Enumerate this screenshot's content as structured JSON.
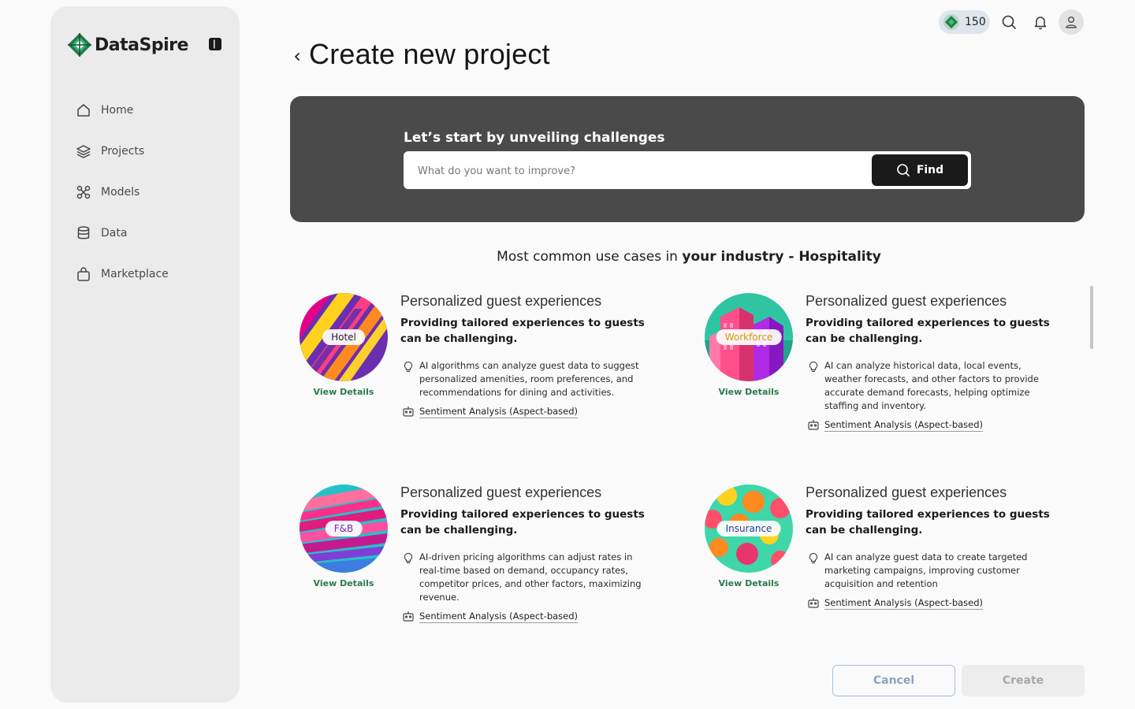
{
  "app": {
    "name": "DataSpire"
  },
  "sidebar": {
    "items": [
      {
        "label": "Home",
        "icon": "home-icon"
      },
      {
        "label": "Projects",
        "icon": "layers-icon"
      },
      {
        "label": "Models",
        "icon": "models-icon"
      },
      {
        "label": "Data",
        "icon": "database-icon"
      },
      {
        "label": "Marketplace",
        "icon": "shopping-bag-icon"
      }
    ]
  },
  "topbar": {
    "credits": "150"
  },
  "header": {
    "title": "Create new project"
  },
  "hero": {
    "title": "Let’s start by unveiling challenges",
    "search_placeholder": "What do you want to improve?",
    "find_label": "Find"
  },
  "industry": {
    "prefix": "Most common use cases in ",
    "emphasis": "your industry - Hospitality"
  },
  "use_cases": [
    {
      "tag": "Hotel",
      "view_details": "View Details",
      "title": "Personalized guest experiences",
      "subtitle": "Providing tailored experiences to guests can be challenging.",
      "description": "AI algorithms can analyze guest data to suggest personalized amenities, room preferences, and recommendations for dining and activities.",
      "model": "Sentiment Analysis (Aspect-based)"
    },
    {
      "tag": "Workforce",
      "view_details": "View Details",
      "title": "Personalized guest experiences",
      "subtitle": "Providing tailored experiences to guests can be challenging.",
      "description": "AI can analyze historical data, local events, weather forecasts, and other factors to provide accurate demand forecasts, helping optimize staffing and inventory.",
      "model": "Sentiment Analysis (Aspect-based)"
    },
    {
      "tag": "F&B",
      "view_details": "View Details",
      "title": "Personalized guest experiences",
      "subtitle": "Providing tailored experiences to guests can be challenging.",
      "description": "AI-driven pricing algorithms can adjust rates in real-time based on demand, occupancy rates, competitor prices, and other factors, maximizing revenue.",
      "model": "Sentiment Analysis (Aspect-based)"
    },
    {
      "tag": "Insurance",
      "view_details": "View Details",
      "title": "Personalized guest experiences",
      "subtitle": "Providing tailored experiences to guests can be challenging.",
      "description": "AI can analyze guest data to create targeted marketing campaigns, improving customer acquisition and retention",
      "model": "Sentiment Analysis (Aspect-based)"
    }
  ],
  "footer": {
    "cancel_label": "Cancel",
    "create_label": "Create"
  },
  "colors": {
    "accent_green": "#2b7a4b",
    "hero_bg": "#4a4a4a",
    "find_bg": "#1a1a1a"
  }
}
